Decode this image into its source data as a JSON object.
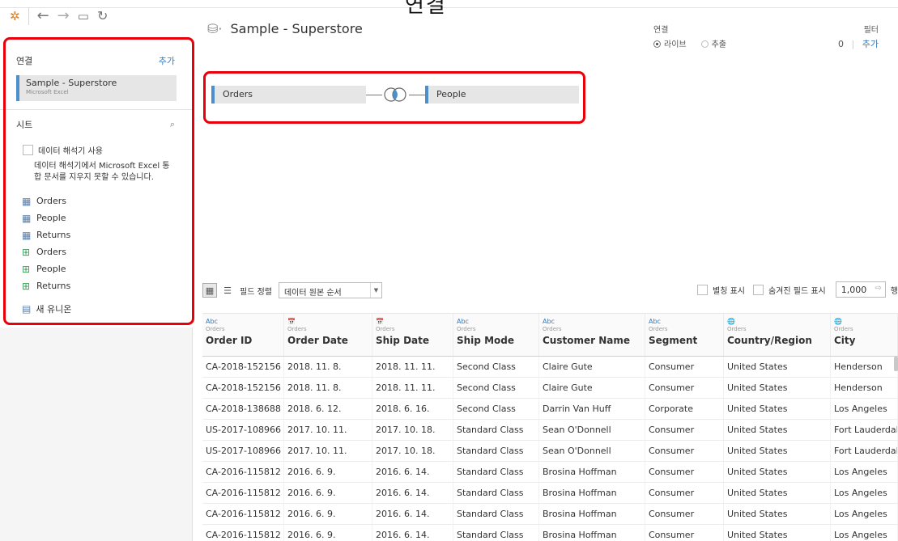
{
  "overlay_title": "연결",
  "sidebar": {
    "connections_heading": "연결",
    "add_label": "추가",
    "connection": {
      "name": "Sample - Superstore",
      "type": "Microsoft Excel"
    },
    "sheets_heading": "시트",
    "interpreter_label": "데이터 해석기 사용",
    "interpreter_note": "데이터 해석기에서 Microsoft Excel 통합 문서를 지우지 못할 수 있습니다.",
    "sheets": [
      "Orders",
      "People",
      "Returns",
      "Orders",
      "People",
      "Returns"
    ],
    "new_union": "새 유니온"
  },
  "datasource": {
    "title": "Sample - Superstore",
    "connection_label": "연결",
    "live_label": "라이브",
    "extract_label": "추출",
    "filter_label": "필터",
    "filter_count": "0",
    "filter_add": "추가"
  },
  "join": {
    "left_table": "Orders",
    "right_table": "People"
  },
  "field_toolbar": {
    "sort_label": "필드 정렬",
    "sort_value": "데이터 원본 순서",
    "alias_label": "별칭 표시",
    "hidden_label": "숨겨진 필드 표시",
    "rows_value": "1,000",
    "rows_suffix": "행"
  },
  "grid": {
    "columns": [
      {
        "type": "Abc",
        "source": "Orders",
        "name": "Order ID"
      },
      {
        "type": "📅",
        "source": "Orders",
        "name": "Order Date"
      },
      {
        "type": "📅",
        "source": "Orders",
        "name": "Ship Date"
      },
      {
        "type": "Abc",
        "source": "Orders",
        "name": "Ship Mode"
      },
      {
        "type": "Abc",
        "source": "Orders",
        "name": "Customer Name"
      },
      {
        "type": "Abc",
        "source": "Orders",
        "name": "Segment"
      },
      {
        "type": "🌐",
        "source": "Orders",
        "name": "Country/Region"
      },
      {
        "type": "🌐",
        "source": "Orders",
        "name": "City"
      }
    ],
    "rows": [
      [
        "CA-2018-152156",
        "2018. 11. 8.",
        "2018. 11. 11.",
        "Second Class",
        "Claire Gute",
        "Consumer",
        "United States",
        "Henderson"
      ],
      [
        "CA-2018-152156",
        "2018. 11. 8.",
        "2018. 11. 11.",
        "Second Class",
        "Claire Gute",
        "Consumer",
        "United States",
        "Henderson"
      ],
      [
        "CA-2018-138688",
        "2018. 6. 12.",
        "2018. 6. 16.",
        "Second Class",
        "Darrin Van Huff",
        "Corporate",
        "United States",
        "Los Angeles"
      ],
      [
        "US-2017-108966",
        "2017. 10. 11.",
        "2017. 10. 18.",
        "Standard Class",
        "Sean O'Donnell",
        "Consumer",
        "United States",
        "Fort Lauderdale"
      ],
      [
        "US-2017-108966",
        "2017. 10. 11.",
        "2017. 10. 18.",
        "Standard Class",
        "Sean O'Donnell",
        "Consumer",
        "United States",
        "Fort Lauderdale"
      ],
      [
        "CA-2016-115812",
        "2016. 6. 9.",
        "2016. 6. 14.",
        "Standard Class",
        "Brosina Hoffman",
        "Consumer",
        "United States",
        "Los Angeles"
      ],
      [
        "CA-2016-115812",
        "2016. 6. 9.",
        "2016. 6. 14.",
        "Standard Class",
        "Brosina Hoffman",
        "Consumer",
        "United States",
        "Los Angeles"
      ],
      [
        "CA-2016-115812",
        "2016. 6. 9.",
        "2016. 6. 14.",
        "Standard Class",
        "Brosina Hoffman",
        "Consumer",
        "United States",
        "Los Angeles"
      ],
      [
        "CA-2016-115812",
        "2016. 6. 9.",
        "2016. 6. 14.",
        "Standard Class",
        "Brosina Hoffman",
        "Consumer",
        "United States",
        "Los Angeles"
      ]
    ]
  },
  "colors": {
    "accent": "#4d8fcc",
    "highlight": "#e8000b",
    "link": "#3a78b5"
  }
}
